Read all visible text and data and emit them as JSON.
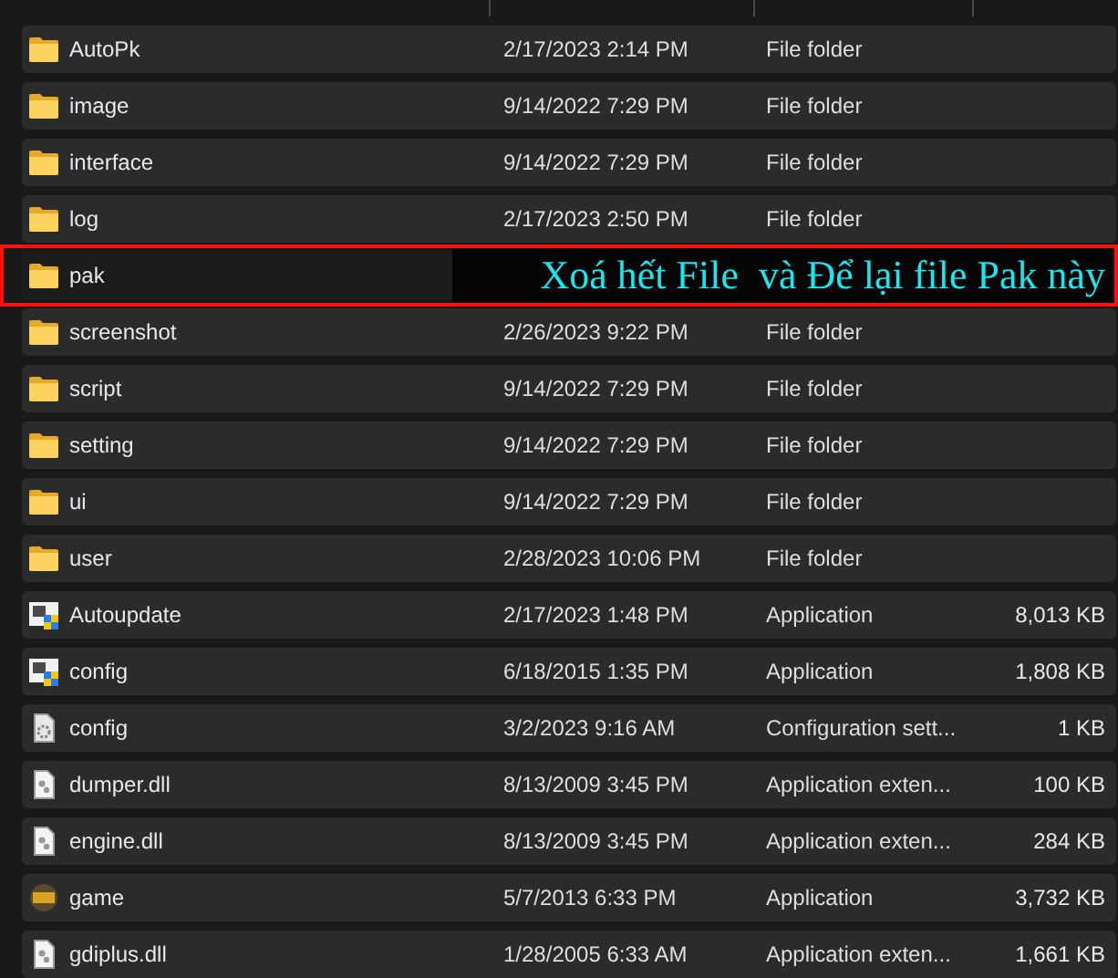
{
  "rows": [
    {
      "kind": "folder",
      "name": "AutoPk",
      "date": "2/17/2023 2:14 PM",
      "type": "File folder",
      "highlighted": false
    },
    {
      "kind": "folder",
      "name": "image",
      "date": "9/14/2022 7:29 PM",
      "type": "File folder",
      "highlighted": false
    },
    {
      "kind": "folder",
      "name": "interface",
      "date": "9/14/2022 7:29 PM",
      "type": "File folder",
      "highlighted": false
    },
    {
      "kind": "folder",
      "name": "log",
      "date": "2/17/2023 2:50 PM",
      "type": "File folder",
      "highlighted": false
    },
    {
      "kind": "folder",
      "name": "pak",
      "highlighted": true,
      "note": "Xoá hết File  và Để lại file Pak này"
    },
    {
      "kind": "folder",
      "name": "screenshot",
      "date": "2/26/2023 9:22 PM",
      "type": "File folder",
      "highlighted": false
    },
    {
      "kind": "folder",
      "name": "script",
      "date": "9/14/2022 7:29 PM",
      "type": "File folder",
      "highlighted": false
    },
    {
      "kind": "folder",
      "name": "setting",
      "date": "9/14/2022 7:29 PM",
      "type": "File folder",
      "highlighted": false
    },
    {
      "kind": "folder",
      "name": "ui",
      "date": "9/14/2022 7:29 PM",
      "type": "File folder",
      "highlighted": false
    },
    {
      "kind": "folder",
      "name": "user",
      "date": "2/28/2023 10:06 PM",
      "type": "File folder",
      "highlighted": false
    },
    {
      "kind": "app",
      "name": "Autoupdate",
      "date": "2/17/2023 1:48 PM",
      "type": "Application",
      "size": "8,013 KB",
      "highlighted": false
    },
    {
      "kind": "app",
      "name": "config",
      "date": "6/18/2015 1:35 PM",
      "type": "Application",
      "size": "1,808 KB",
      "highlighted": false
    },
    {
      "kind": "settings",
      "name": "config",
      "date": "3/2/2023 9:16 AM",
      "type": "Configuration sett...",
      "size": "1 KB",
      "highlighted": false
    },
    {
      "kind": "dll",
      "name": "dumper.dll",
      "date": "8/13/2009 3:45 PM",
      "type": "Application exten...",
      "size": "100 KB",
      "highlighted": false
    },
    {
      "kind": "dll",
      "name": "engine.dll",
      "date": "8/13/2009 3:45 PM",
      "type": "Application exten...",
      "size": "284 KB",
      "highlighted": false
    },
    {
      "kind": "game",
      "name": "game",
      "date": "5/7/2013 6:33 PM",
      "type": "Application",
      "size": "3,732 KB",
      "highlighted": false
    },
    {
      "kind": "dll",
      "name": "gdiplus.dll",
      "date": "1/28/2005 6:33 AM",
      "type": "Application exten...",
      "size": "1,661 KB",
      "highlighted": false
    }
  ]
}
